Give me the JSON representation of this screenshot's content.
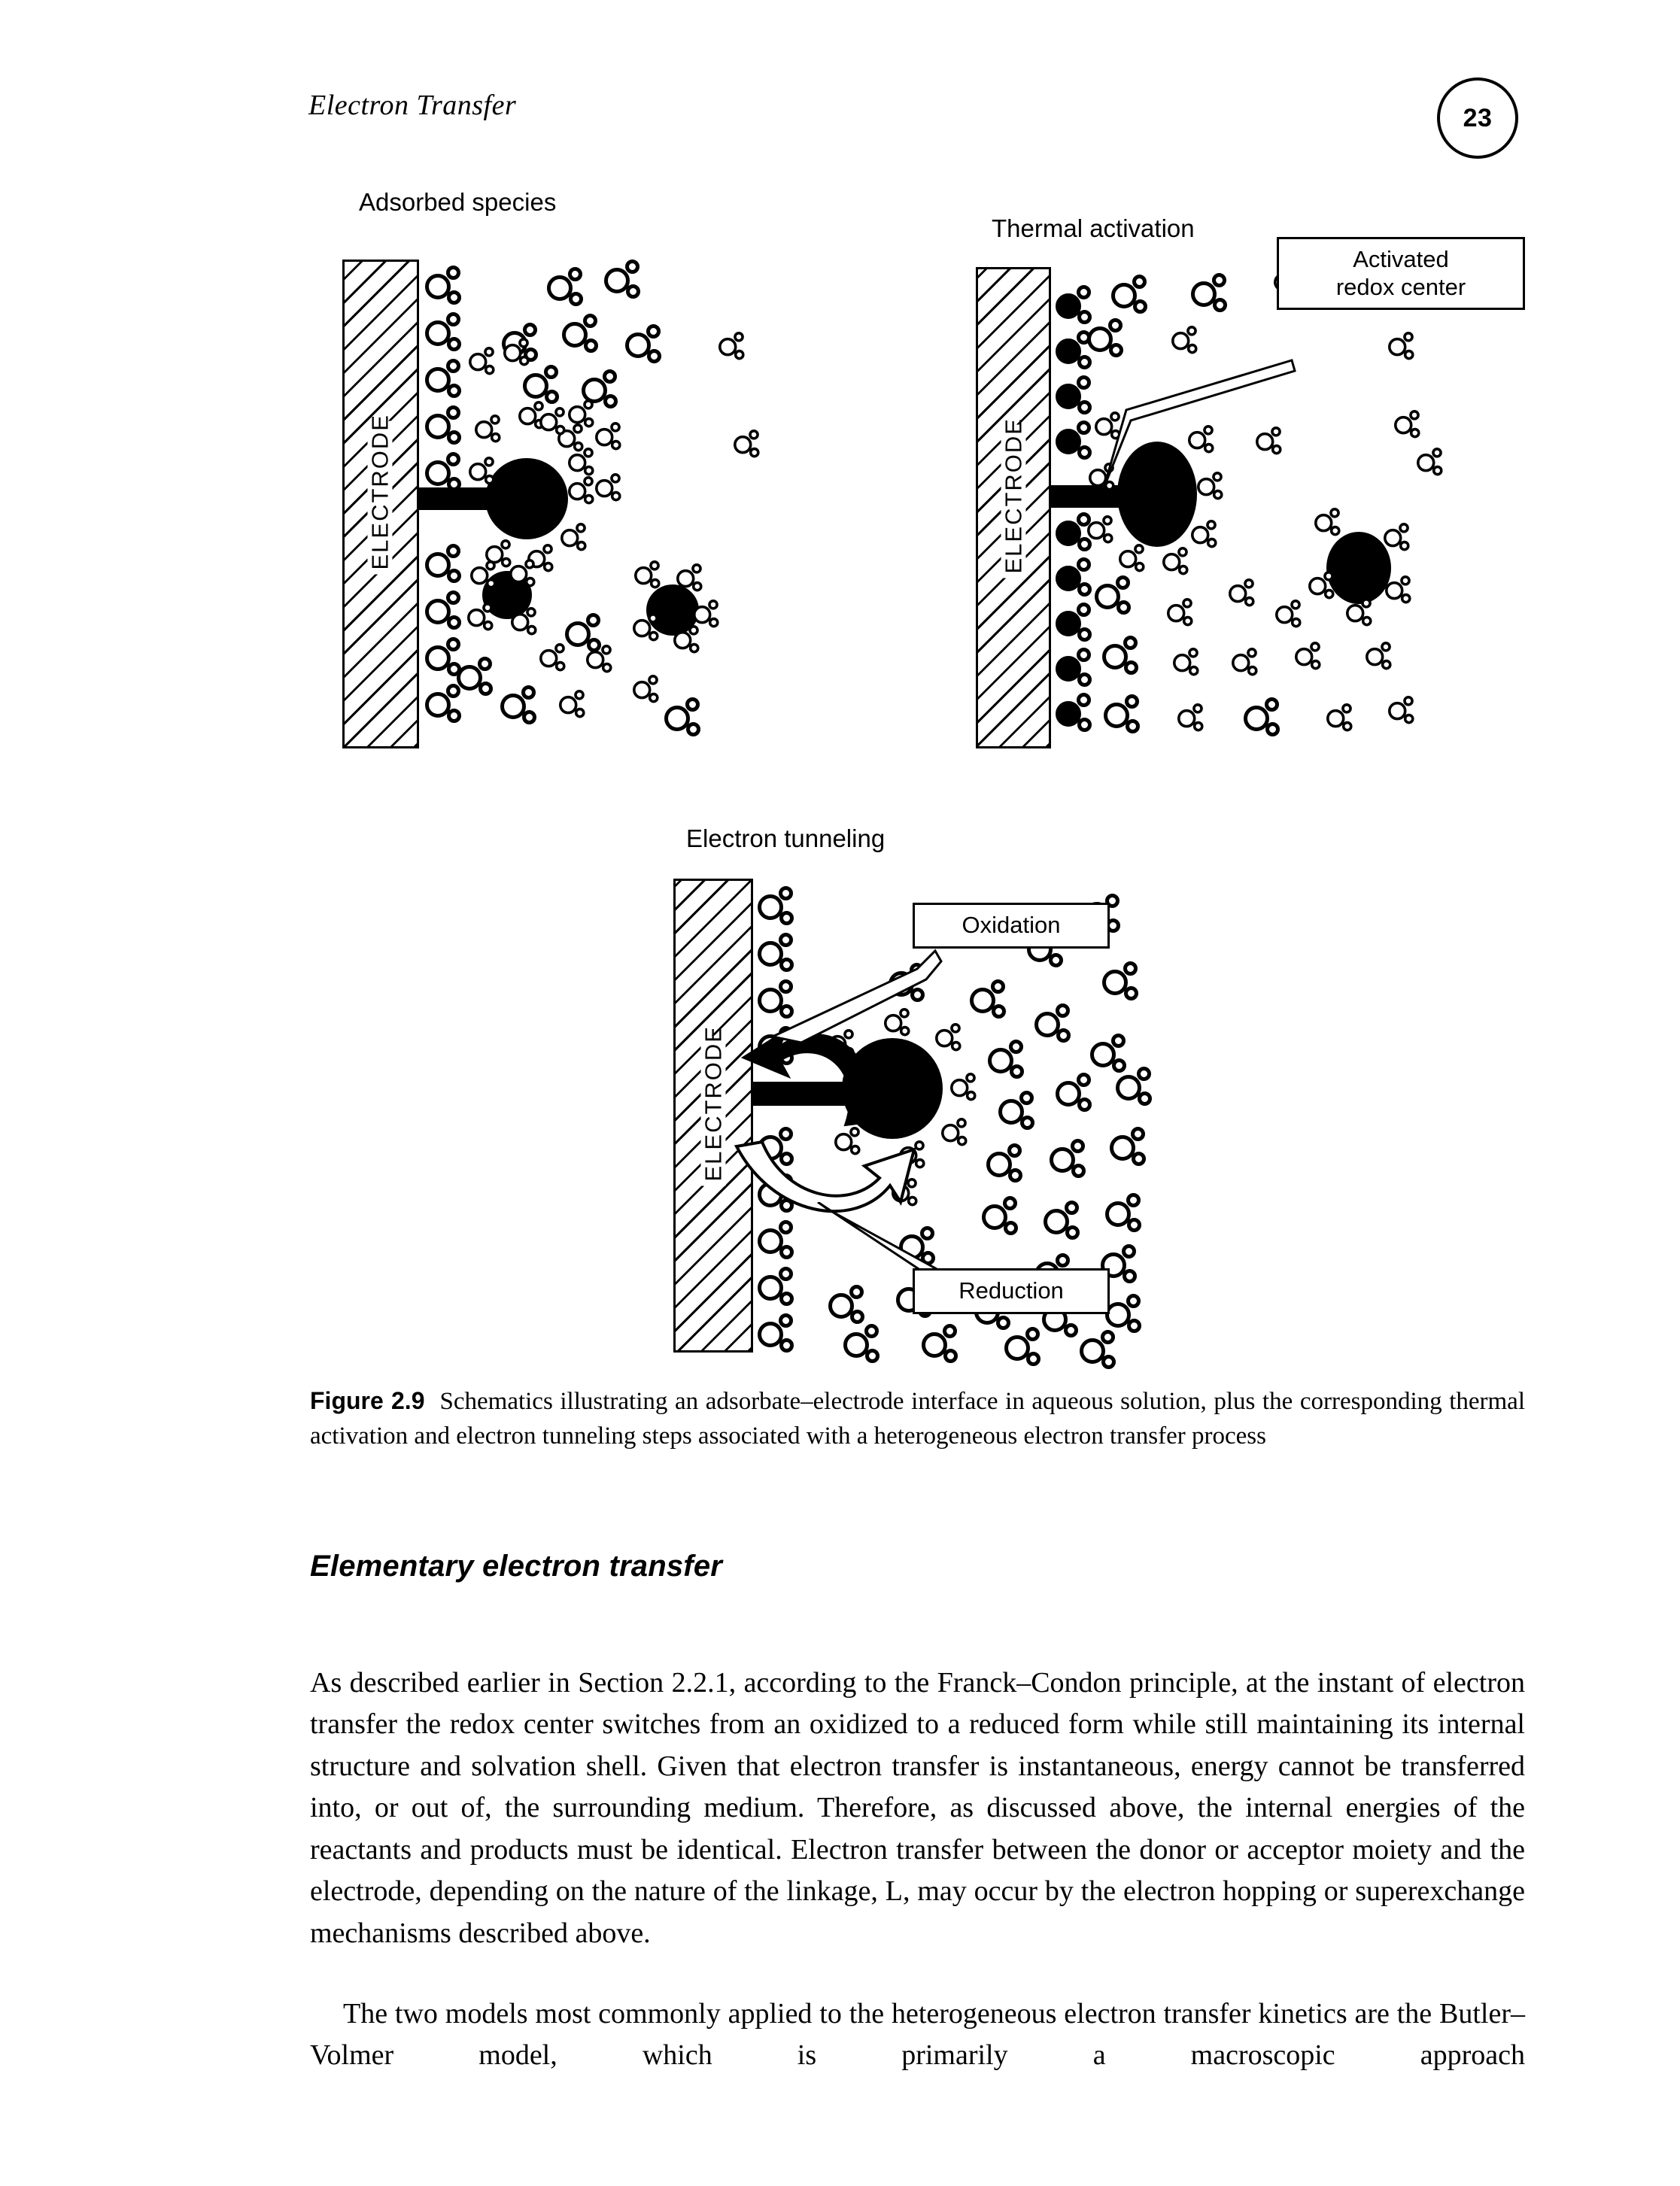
{
  "header": {
    "running_head": "Electron Transfer",
    "page_number": "23"
  },
  "figure": {
    "panels": [
      {
        "id": "adsorbed-species",
        "title": "Adsorbed species",
        "electrode_label": "ELECTRODE",
        "callouts": []
      },
      {
        "id": "thermal-activation",
        "title": "Thermal activation",
        "electrode_label": "ELECTRODE",
        "callouts": [
          {
            "id": "activated-redox-center",
            "line1": "Activated",
            "line2": "redox center"
          }
        ]
      },
      {
        "id": "electron-tunneling",
        "title": "Electron tunneling",
        "electrode_label": "ELECTRODE",
        "callouts": [
          {
            "id": "oxidation",
            "line1": "Oxidation",
            "line2": ""
          },
          {
            "id": "reduction",
            "line1": "Reduction",
            "line2": ""
          }
        ]
      }
    ],
    "caption": {
      "number": "Figure 2.9",
      "text": "Schematics illustrating an adsorbate–electrode interface in aqueous solution, plus the corresponding thermal activation and electron tunneling steps associated with a heterogeneous electron transfer process"
    }
  },
  "content": {
    "section_heading": "Elementary electron transfer",
    "paragraph_1": "As described earlier in Section 2.2.1, according to the Franck–Condon principle, at the instant of electron transfer the redox center switches from an oxidized to a reduced form while still maintaining its internal structure and solvation shell. Given that electron transfer is instantaneous, energy cannot be transferred into, or out of, the surrounding medium. Therefore, as discussed above, the internal energies of the reactants and products must be identical. Electron transfer between the donor or acceptor moiety and the electrode, depending on the nature of the linkage, L, may occur by the electron hopping or superexchange mechanisms described above.",
    "paragraph_2": "The two models most commonly applied to the heterogeneous electron transfer kinetics are the Butler–Volmer model, which is primarily a macroscopic approach"
  },
  "colors": {
    "ink": "#000000",
    "paper": "#ffffff"
  }
}
